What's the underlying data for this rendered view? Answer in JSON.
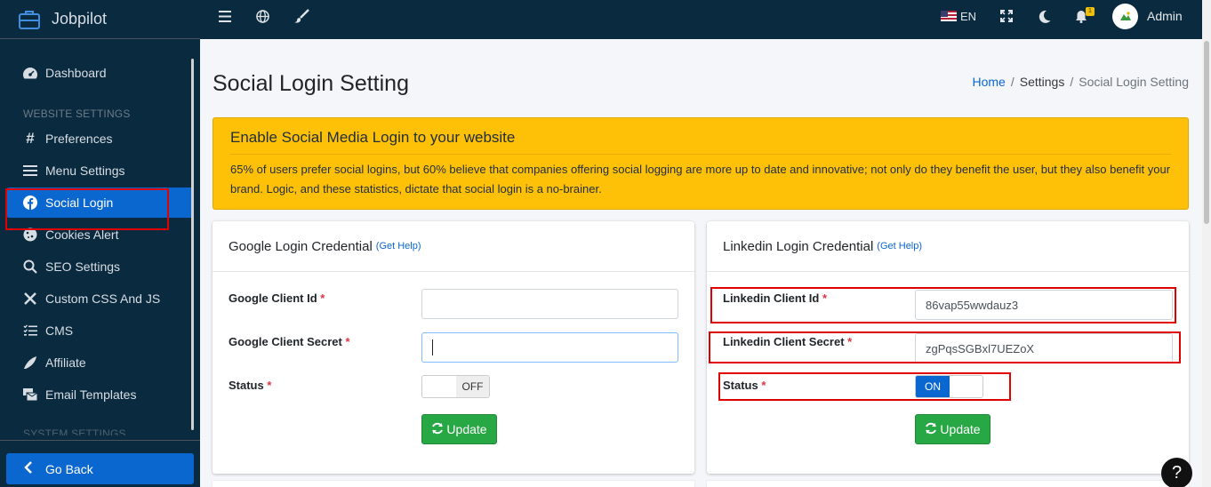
{
  "brand": {
    "name": "Jobpilot",
    "icon": "briefcase-icon"
  },
  "topbar": {
    "icons": [
      "menu-icon",
      "globe-icon",
      "brush-icon"
    ],
    "language": "EN",
    "notification_count": "1",
    "user_name": "Admin"
  },
  "sidebar": {
    "items": [
      {
        "label": "Dashboard",
        "icon": "dashboard-icon"
      },
      {
        "label": "Preferences",
        "icon": "hash-icon"
      },
      {
        "label": "Menu Settings",
        "icon": "bars-icon"
      },
      {
        "label": "Social Login",
        "icon": "facebook-icon",
        "active": true
      },
      {
        "label": "Cookies Alert",
        "icon": "cookie-icon"
      },
      {
        "label": "SEO Settings",
        "icon": "search-icon"
      },
      {
        "label": "Custom CSS And JS",
        "icon": "tools-icon"
      },
      {
        "label": "CMS",
        "icon": "list-check-icon"
      },
      {
        "label": "Affiliate",
        "icon": "affiliate-icon"
      },
      {
        "label": "Email Templates",
        "icon": "mail-bulk-icon"
      }
    ],
    "section_website": "WEBSITE SETTINGS",
    "section_system": "SYSTEM SETTINGS",
    "go_back": "Go Back"
  },
  "page": {
    "title": "Social Login Setting",
    "breadcrumb": {
      "home": "Home",
      "settings": "Settings",
      "current": "Social Login Setting"
    }
  },
  "alert": {
    "title": "Enable Social Media Login to your website",
    "text": "65% of users prefer social logins, but 60% believe that companies offering social logging are more up to date and innovative; not only do they benefit the user, but they also benefit your brand. Logic, and these statistics, dictate that social login is a no-brainer."
  },
  "google": {
    "title": "Google Login Credential",
    "help": "(Get Help)",
    "client_id_label": "Google Client Id",
    "client_id_value": "",
    "client_secret_label": "Google Client Secret",
    "client_secret_value": "",
    "status_label": "Status",
    "status_value": "OFF",
    "update": "Update"
  },
  "linkedin": {
    "title": "Linkedin Login Credential",
    "help": "(Get Help)",
    "client_id_label": "Linkedin Client Id",
    "client_id_value": "86vap55wwdauz3",
    "client_secret_label": "Linkedin Client Secret",
    "client_secret_value": "zgPqsSGBxl7UEZoX",
    "status_label": "Status",
    "status_value": "ON",
    "update": "Update"
  },
  "required_mark": "*",
  "help_fab": "?",
  "colors": {
    "sidebar": "#0a2a3f",
    "accent": "#0b67d0",
    "alert": "#ffc107",
    "success": "#28a745",
    "highlight": "#e00000"
  }
}
